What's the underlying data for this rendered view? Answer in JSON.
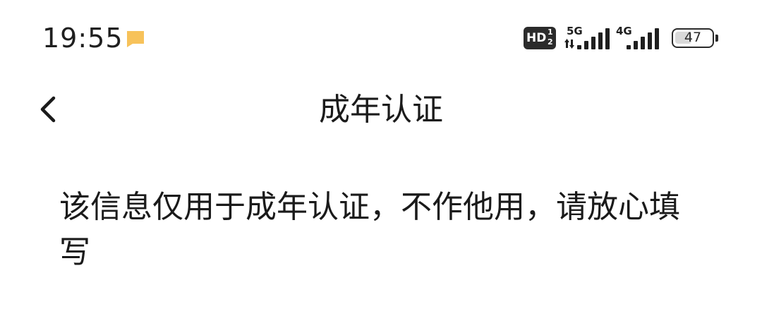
{
  "status_bar": {
    "time": "19:55",
    "hd_label": "HD",
    "hd_sub_top": "1",
    "hd_sub_bottom": "2",
    "sim1_network": "5G",
    "sim2_network": "4G",
    "battery_level": "47",
    "battery_fraction": 0.47,
    "notification_color": "#F7C25A",
    "icons": [
      "notification-icon",
      "hd-voice-icon",
      "signal-icon",
      "battery-icon"
    ]
  },
  "nav": {
    "back_icon": "chevron-left-icon",
    "title": "成年认证"
  },
  "notice": {
    "text": "该信息仅用于成年认证，不作他用，请放心填写"
  }
}
